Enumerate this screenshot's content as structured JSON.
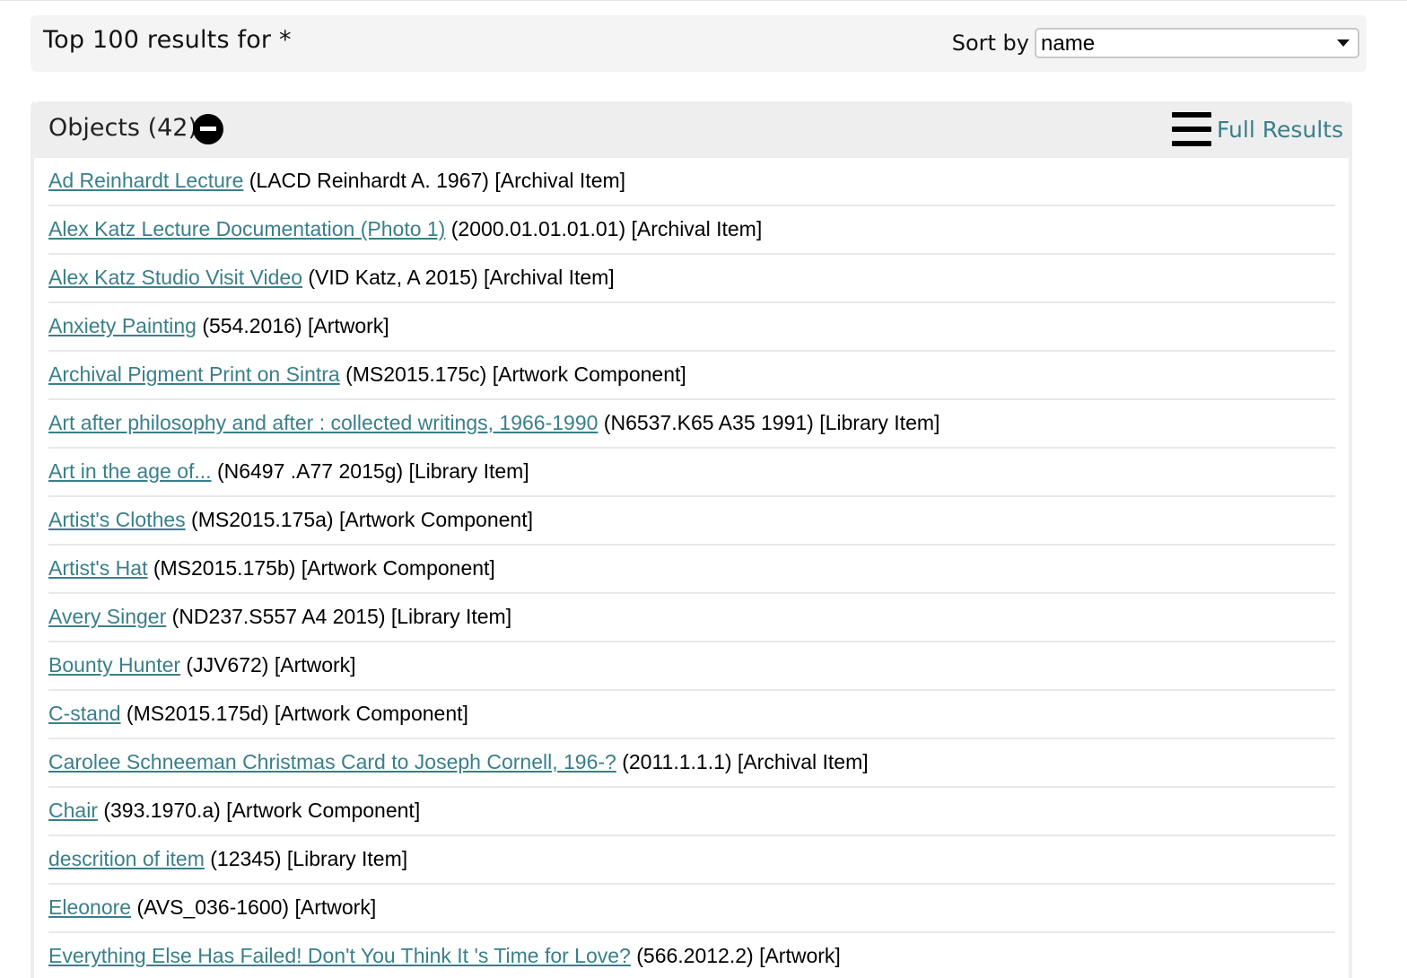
{
  "header": {
    "title": "Top 100 results for  *",
    "sort_label": "Sort by",
    "sort_value": "name"
  },
  "objects": {
    "title": "Objects (42)",
    "full_results_label": "Full Results",
    "items": [
      {
        "link": "Ad Reinhardt Lecture",
        "meta": " (LACD Reinhardt A. 1967) [Archival Item]"
      },
      {
        "link": "Alex Katz Lecture Documentation (Photo 1)",
        "meta": " (2000.01.01.01.01) [Archival Item]"
      },
      {
        "link": "Alex Katz Studio Visit Video",
        "meta": " (VID Katz, A 2015) [Archival Item]"
      },
      {
        "link": "Anxiety Painting",
        "meta": " (554.2016) [Artwork]"
      },
      {
        "link": "Archival Pigment Print on Sintra",
        "meta": " (MS2015.175c) [Artwork Component]"
      },
      {
        "link": "Art after philosophy and after : collected writings, 1966-1990",
        "meta": " (N6537.K65 A35 1991) [Library Item]"
      },
      {
        "link": "Art in the age of...",
        "meta": " (N6497 .A77 2015g) [Library Item]"
      },
      {
        "link": "Artist's Clothes",
        "meta": " (MS2015.175a) [Artwork Component]"
      },
      {
        "link": "Artist's Hat",
        "meta": " (MS2015.175b) [Artwork Component]"
      },
      {
        "link": "Avery Singer",
        "meta": " (ND237.S557 A4 2015) [Library Item]"
      },
      {
        "link": "Bounty Hunter",
        "meta": " (JJV672) [Artwork]"
      },
      {
        "link": "C-stand",
        "meta": " (MS2015.175d) [Artwork Component]"
      },
      {
        "link": "Carolee Schneeman Christmas Card to Joseph Cornell, 196-?",
        "meta": " (2011.1.1.1) [Archival Item]"
      },
      {
        "link": "Chair",
        "meta": " (393.1970.a) [Artwork Component]"
      },
      {
        "link": "descrition of item",
        "meta": " (12345) [Library Item]"
      },
      {
        "link": "Eleonore",
        "meta": " (AVS_036-1600) [Artwork]"
      },
      {
        "link": "Everything Else Has Failed! Don't You Think It 's Time for Love?",
        "meta": " (566.2012.2) [Artwork]"
      }
    ]
  }
}
